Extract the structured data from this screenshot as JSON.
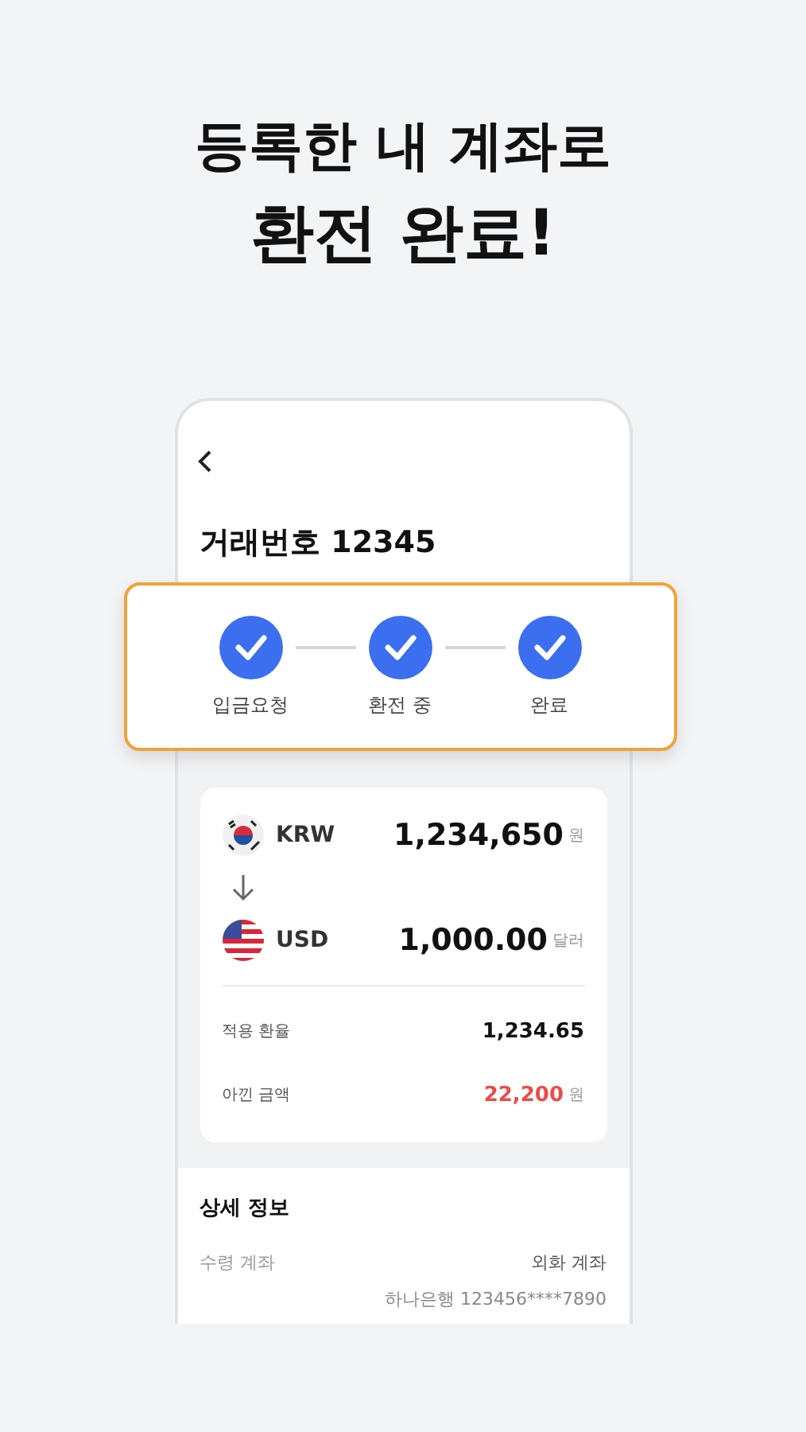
{
  "headline": {
    "line_1": "등록한 내 계좌로",
    "line_2": "환전 완료!"
  },
  "screen": {
    "title": "거래번호 12345",
    "steps": [
      {
        "label": "입금요청",
        "done": true
      },
      {
        "label": "환전 중",
        "done": true
      },
      {
        "label": "완료",
        "done": true
      }
    ],
    "exchange": {
      "from": {
        "currency": "KRW",
        "kind": "kr",
        "amount": "1,234,650",
        "unit": "원"
      },
      "to": {
        "currency": "USD",
        "kind": "us",
        "amount": "1,000.00",
        "unit": "달러"
      },
      "rate_label": "적용 환율",
      "rate": "1,234.65",
      "saved_label": "아낀 금액",
      "saved": "22,200",
      "saved_unit": "원"
    },
    "details": {
      "title": "상세 정보",
      "rows": [
        {
          "label": "수령 계좌",
          "value": "외화 계좌"
        },
        {
          "value": "하나은행 123456****7890"
        }
      ]
    }
  }
}
